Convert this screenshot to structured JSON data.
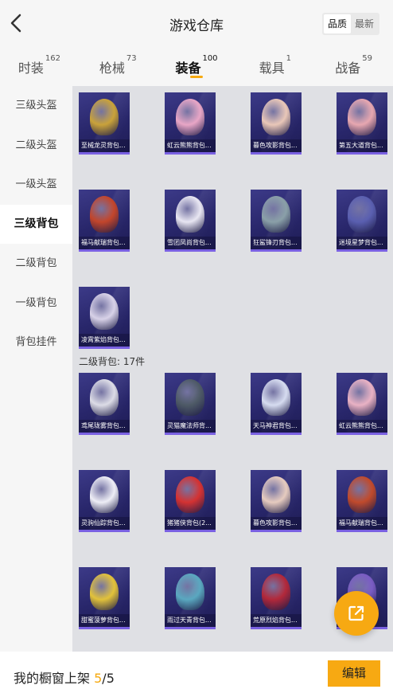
{
  "header": {
    "title": "游戏仓库",
    "sort_options": [
      "品质",
      "最新"
    ],
    "active_sort": 0
  },
  "tabs": [
    {
      "label": "时装",
      "count": "162"
    },
    {
      "label": "枪械",
      "count": "73"
    },
    {
      "label": "装备",
      "count": "100"
    },
    {
      "label": "载具",
      "count": "1"
    },
    {
      "label": "战备",
      "count": "59"
    }
  ],
  "active_tab": 2,
  "sidebar": {
    "items": [
      "三级头盔",
      "二级头盔",
      "一级头盔",
      "三级背包",
      "二级背包",
      "一级背包",
      "背包挂件"
    ],
    "active": 3
  },
  "section_label": "二级背包: 17件",
  "items_level3": [
    {
      "label": "至械龙灵背包...",
      "color": "#c9a23a"
    },
    {
      "label": "虹云熊熊背包...",
      "color": "#e8a6c6"
    },
    {
      "label": "暮色攻影背包...",
      "color": "#e9c7b8"
    },
    {
      "label": "第五大道背包...",
      "color": "#e7a7b0"
    },
    {
      "label": "福马献瑞背包...",
      "color": "#c2452b"
    },
    {
      "label": "雪团凤尚背包...",
      "color": "#e8e6f2"
    },
    {
      "label": "狂鲨锋刃背包...",
      "color": "#8aa0a8"
    },
    {
      "label": "迷境星梦背包...",
      "color": "#5a5fb0"
    },
    {
      "label": "凌霄紫焰背包...",
      "color": "#d8d2e8"
    }
  ],
  "items_level2": [
    {
      "label": "鸢尾珑雾背包...",
      "color": "#dcdce6"
    },
    {
      "label": "灵猫魔法师背...",
      "color": "#4e5a66"
    },
    {
      "label": "天马神君背包...",
      "color": "#d6dcf0"
    },
    {
      "label": "虹云熊熊背包...",
      "color": "#e9b2c4"
    },
    {
      "label": "灵驹仙踪背包...",
      "color": "#eeeef6"
    },
    {
      "label": "猪猪侠背包(2...",
      "color": "#d43232"
    },
    {
      "label": "暮色攻影背包...",
      "color": "#e6cbbf"
    },
    {
      "label": "福马献瑞背包...",
      "color": "#c04a2c"
    },
    {
      "label": "甜蜜菠萝背包...",
      "color": "#e2c23a"
    },
    {
      "label": "雨过天青背包...",
      "color": "#5aa8c0"
    },
    {
      "label": "荒原烈焰背包...",
      "color": "#b2283a"
    },
    {
      "label": "",
      "color": "#7a5cc4"
    }
  ],
  "bottom": {
    "shelf_label": "我的橱窗上架",
    "shelf_count": "5",
    "shelf_total": "/5",
    "edit_label": "编辑"
  },
  "colors": {
    "accent": "#f7a912",
    "card_border": "#7a61e2"
  },
  "icons": {
    "back": "chevron-left-icon",
    "fab": "share-external-icon"
  }
}
